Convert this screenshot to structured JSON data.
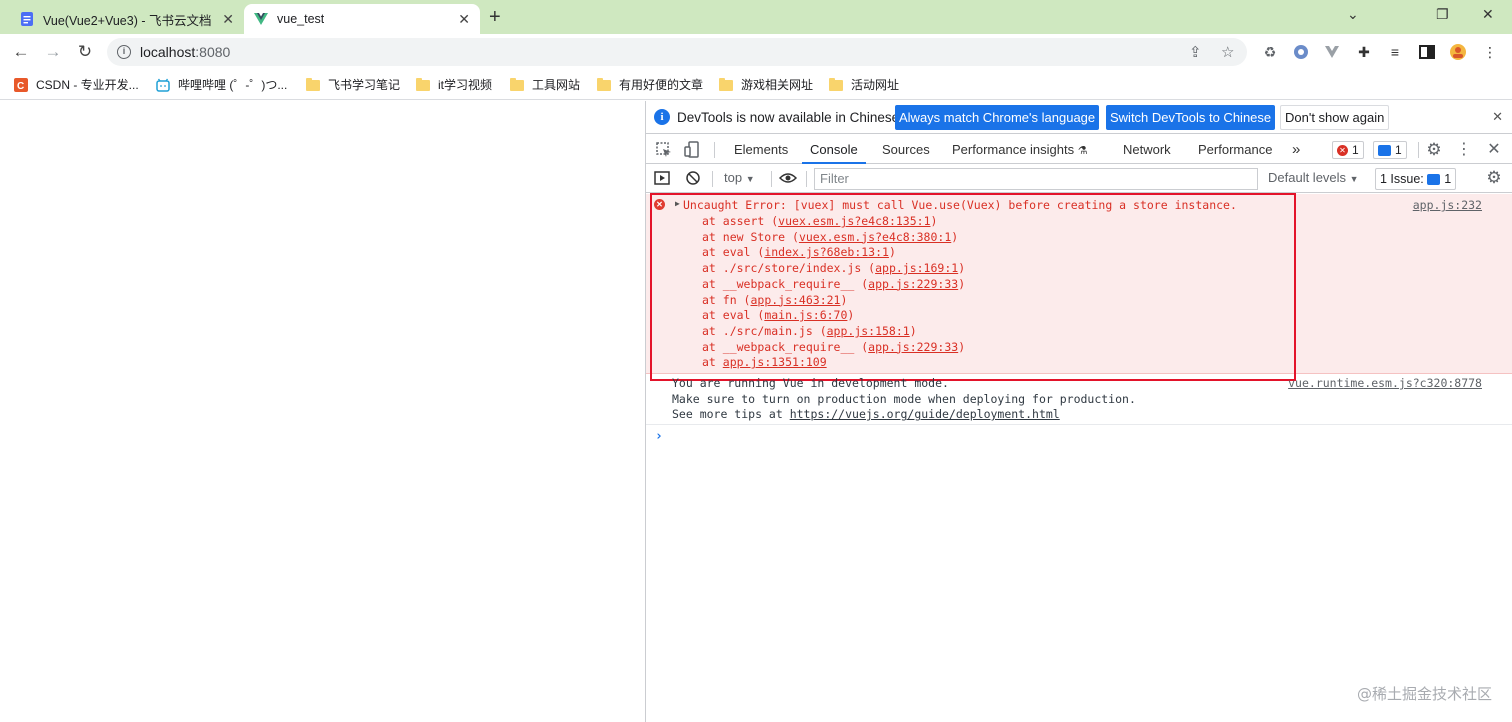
{
  "browser": {
    "tabs": [
      {
        "title": "Vue(Vue2+Vue3) - 飞书云文档",
        "close": "✕"
      },
      {
        "title": "vue_test",
        "close": "✕"
      }
    ],
    "new_tab": "+",
    "window_controls": {
      "minimize": "⌄",
      "restore": "❐",
      "close": "✕"
    },
    "url_host": "localhost",
    "url_port": ":8080",
    "toolbar_icons": [
      "back-icon",
      "forward-icon",
      "reload-icon",
      "info-icon",
      "share-icon",
      "star-icon",
      "recycle-icon",
      "extension-icon",
      "vue-devtools-icon",
      "puzzle-icon",
      "media-icon",
      "sidepanel-icon",
      "profile-icon",
      "menu-icon"
    ]
  },
  "bookmarks": [
    {
      "label": "CSDN - 专业开发...",
      "icon": "csdn-icon"
    },
    {
      "label": "哔哩哔哩 (゜-゜)つ...",
      "icon": "bilibili-icon"
    },
    {
      "label": "飞书学习笔记",
      "icon": "folder-icon"
    },
    {
      "label": "it学习视频",
      "icon": "folder-icon"
    },
    {
      "label": "工具网站",
      "icon": "folder-icon"
    },
    {
      "label": "有用好便的文章",
      "icon": "folder-icon"
    },
    {
      "label": "游戏相关网址",
      "icon": "folder-icon"
    },
    {
      "label": "活动网址",
      "icon": "folder-icon"
    }
  ],
  "devtools": {
    "infobar": {
      "message": "DevTools is now available in Chinese!",
      "btn_match": "Always match Chrome's language",
      "btn_switch": "Switch DevTools to Chinese",
      "btn_dismiss": "Don't show again"
    },
    "tabs": [
      "Elements",
      "Console",
      "Sources",
      "Performance insights",
      "Network",
      "Performance"
    ],
    "more": "»",
    "error_count": "1",
    "message_count": "1",
    "console_toolbar": {
      "context": "top",
      "filter_placeholder": "Filter",
      "levels": "Default levels",
      "issues_label": "1 Issue:",
      "issues_count": "1"
    },
    "error": {
      "message": "Uncaught Error: [vuex] must call Vue.use(Vuex) before creating a store instance.",
      "source": "app.js:232",
      "stack": [
        {
          "prefix": "at assert (",
          "link": "vuex.esm.js?e4c8:135:1",
          "suffix": ")"
        },
        {
          "prefix": "at new Store (",
          "link": "vuex.esm.js?e4c8:380:1",
          "suffix": ")"
        },
        {
          "prefix": "at eval (",
          "link": "index.js?68eb:13:1",
          "suffix": ")"
        },
        {
          "prefix": "at ./src/store/index.js (",
          "link": "app.js:169:1",
          "suffix": ")"
        },
        {
          "prefix": "at __webpack_require__ (",
          "link": "app.js:229:33",
          "suffix": ")"
        },
        {
          "prefix": "at fn (",
          "link": "app.js:463:21",
          "suffix": ")"
        },
        {
          "prefix": "at eval (",
          "link": "main.js:6:70",
          "suffix": ")"
        },
        {
          "prefix": "at ./src/main.js (",
          "link": "app.js:158:1",
          "suffix": ")"
        },
        {
          "prefix": "at __webpack_require__ (",
          "link": "app.js:229:33",
          "suffix": ")"
        },
        {
          "prefix": "at ",
          "link": "app.js:1351:109",
          "suffix": ""
        }
      ]
    },
    "info": {
      "line1": "You are running Vue in development mode.",
      "line2": "Make sure to turn on production mode when deploying for production.",
      "line3_prefix": "See more tips at ",
      "line3_link": "https://vuejs.org/guide/deployment.html",
      "source": "vue.runtime.esm.js?c320:8778"
    },
    "prompt": "›"
  },
  "watermark": "@稀土掘金技术社区",
  "colors": {
    "tabstrip": "#cfe8c0",
    "accent": "#1a73e8",
    "error": "#d93025",
    "highlight_box": "#e3132a"
  }
}
